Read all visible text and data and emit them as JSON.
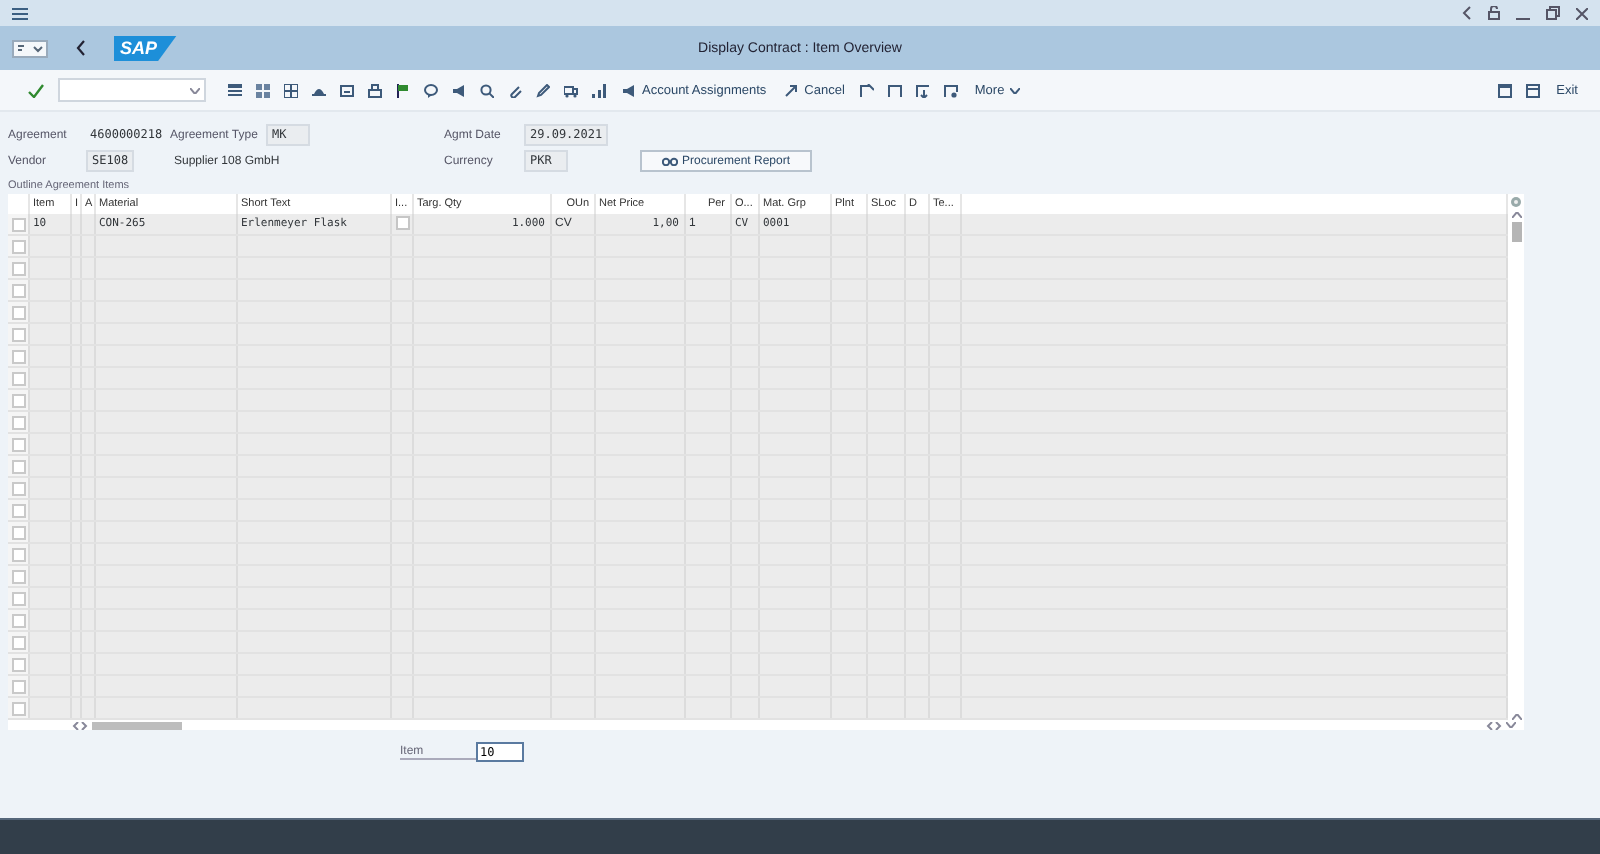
{
  "window": {
    "title": "Display Contract : Item Overview"
  },
  "logo": {
    "text": "SAP"
  },
  "toolbar": {
    "buttons": [
      {
        "label": "Account Assignments",
        "kind": "icon-text"
      },
      {
        "label": "Cancel",
        "kind": "icon-text"
      },
      {
        "label": "More",
        "kind": "dropdown"
      }
    ],
    "exit": "Exit"
  },
  "header_rows": [
    [
      {
        "label": "Agreement",
        "value": "4600000218",
        "kind": "text"
      },
      {
        "label": "Agreement Type",
        "value": "MK",
        "kind": "box"
      },
      {
        "label": "Agmt Date",
        "value": "29.09.2021",
        "kind": "box"
      }
    ],
    [
      {
        "label": "Vendor",
        "value": "SE108",
        "kind": "box"
      },
      {
        "value": "Supplier 108 GmbH",
        "kind": "text"
      },
      {
        "label": "Currency",
        "value": "PKR",
        "kind": "box"
      }
    ]
  ],
  "report_button": {
    "label": "Procurement Report"
  },
  "table": {
    "title": "Outline Agreement Items",
    "columns": [
      "Item",
      "I",
      "A",
      "Material",
      "Short Text",
      "I...",
      "Targ. Qty",
      "OUn",
      "Net Price",
      "Per",
      "O...",
      "Mat. Grp",
      "Plnt",
      "SLoc",
      "D",
      "Te..."
    ],
    "rows": [
      {
        "selected": false,
        "cells": [
          "10",
          "",
          "",
          "CON-265",
          "Erlenmeyer Flask",
          {
            "checked": false
          },
          "1.000",
          "CV",
          "1,00",
          "1",
          "CV",
          "0001",
          "",
          "",
          "",
          ""
        ]
      }
    ]
  },
  "item_field": {
    "label": "Item",
    "value": "10"
  }
}
